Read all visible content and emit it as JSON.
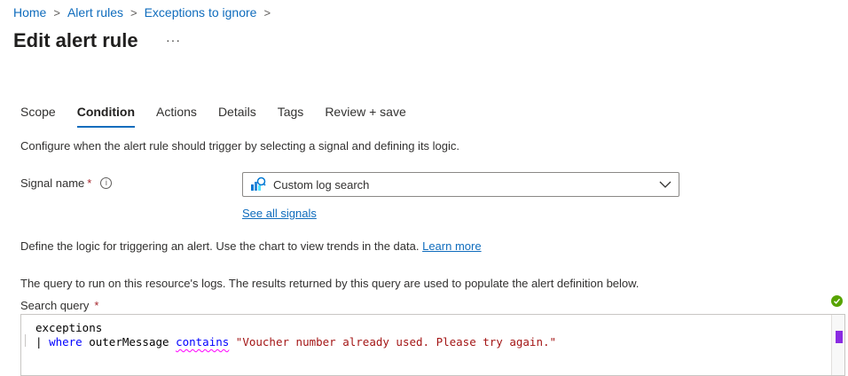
{
  "breadcrumb": {
    "items": [
      "Home",
      "Alert rules",
      "Exceptions to ignore"
    ],
    "separator": ">"
  },
  "page": {
    "title": "Edit alert rule",
    "more_label": "···"
  },
  "tabs": [
    {
      "label": "Scope",
      "active": false
    },
    {
      "label": "Condition",
      "active": true
    },
    {
      "label": "Actions",
      "active": false
    },
    {
      "label": "Details",
      "active": false
    },
    {
      "label": "Tags",
      "active": false
    },
    {
      "label": "Review + save",
      "active": false
    }
  ],
  "condition": {
    "description": "Configure when the alert rule should trigger by selecting a signal and defining its logic.",
    "signal_label": "Signal name",
    "required_mark": "*",
    "info_glyph": "i",
    "signal_value": "Custom log search",
    "see_all_signals": "See all signals",
    "logic_text": "Define the logic for triggering an alert. Use the chart to view trends in the data.",
    "learn_more": "Learn more",
    "query_description": "The query to run on this resource's logs. The results returned by this query are used to populate the alert definition below.",
    "search_query_label": "Search query"
  },
  "query": {
    "line1": "exceptions",
    "pipe": "| ",
    "where": "where",
    "field": " outerMessage ",
    "contains": "contains",
    "string": " \"Voucher number already used. Please try again.\""
  },
  "colors": {
    "accent": "#0f6cbd",
    "required": "#a4262c",
    "success": "#57a300",
    "keyword": "#0000ff",
    "string": "#a31515"
  },
  "icons": [
    "chevron-right-icon",
    "more-icon",
    "info-icon",
    "custom-log-search-icon",
    "chevron-down-icon",
    "check-circle-icon"
  ]
}
